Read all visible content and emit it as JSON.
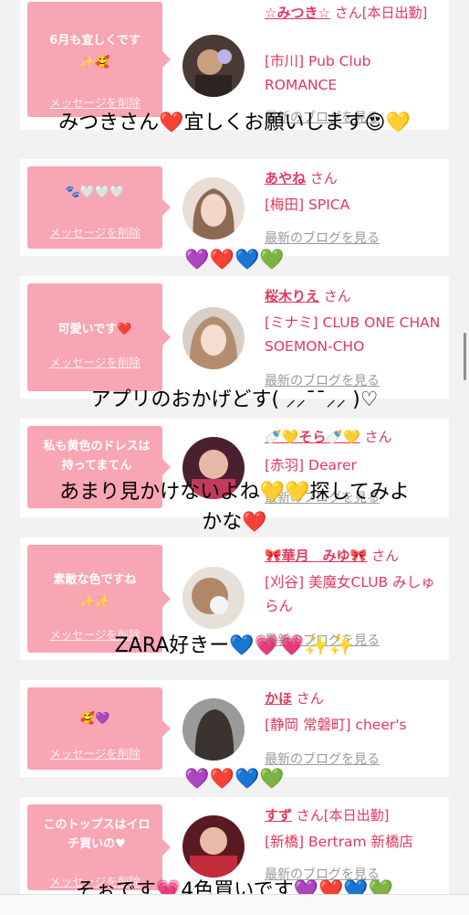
{
  "delete_label": "メッセージを削除",
  "blog_label": "最新のブログを見る",
  "cards": [
    {
      "message": "6月も宜しくです",
      "message2": "✨🥰",
      "name": "☆みつき☆",
      "san": "さん[本日出勤]",
      "shop": "[市川] Pub Club ROMANCE",
      "blog": "最新のブログを見る"
    },
    {
      "message": "🐾🤍🤍🤍",
      "name": "あやね",
      "san": "さん",
      "shop": "[梅田] SPICA",
      "blog": "最新のブログを見る"
    },
    {
      "message": "可愛いです❤️",
      "name": "桜木りえ",
      "san": "さん",
      "shop": "[ミナミ] CLUB ONE CHAN SOEMON-CHO",
      "blog": "最新のブログを見る"
    },
    {
      "message": "私も黄色のドレスは持ってまてん",
      "name": "🍼💛そら🍼💛",
      "san": "さん",
      "shop": "[赤羽] Dearer",
      "blog": "最新のブログを見る"
    },
    {
      "message": "素敵な色ですね",
      "message2": "✨✨",
      "name": "🎀華月　みゆ🎀",
      "san": "さん",
      "shop": "[刈谷] 美魔女CLUB みしゅらん",
      "blog": "最新のブログを見る"
    },
    {
      "message": "🥰💜",
      "name": "かほ",
      "san": "さん",
      "shop": "[静岡 常磐町] cheer's",
      "blog": "最新のブログを見る"
    },
    {
      "message": "このトップスはイロチ買いの♥",
      "name": "すず",
      "san": "さん[本日出勤]",
      "shop": "[新橋] Bertram 新橋店",
      "blog": "最新のブログを見る"
    }
  ],
  "overlays": [
    "みつきさん❤️宜しくお願いします😍💛",
    "💜❤️💙💚",
    "アプリのおかげどす( ⸝⸝¯¯⸝⸝ )♡",
    "あまり見かけないよね💛💛探してみよ",
    "かな❤️",
    "ZARA好きー💙💗💗✨✨",
    "💜❤️💙💚",
    "そぉです💗4色買いです💜❤️💙💚"
  ],
  "colors": {
    "bubble": "#f8a5b4",
    "accent": "#e2385e",
    "muted": "#9a9a9a"
  }
}
